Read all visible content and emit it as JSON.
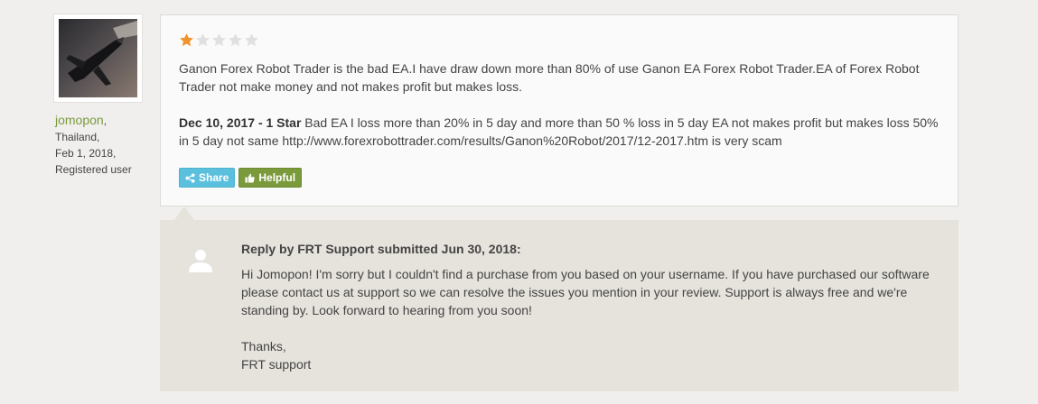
{
  "reviewer": {
    "username": "jomopon",
    "username_suffix": ",",
    "country": "Thailand,",
    "date": "Feb 1, 2018,",
    "role": "Registered user"
  },
  "review": {
    "rating": 1,
    "max_rating": 5,
    "star_filled_color": "#f0932b",
    "star_empty_color": "#e0e0e0",
    "paragraph1": "Ganon Forex Robot Trader is the bad EA.I have draw down more than 80% of use Ganon EA Forex Robot Trader.EA of Forex Robot Trader not make money and not makes profit but makes loss.",
    "update_label": "Dec 10, 2017 - 1 Star",
    "update_text": " Bad EA I loss more than 20% in 5 day and more than 50 % loss in 5 day EA not makes profit but makes loss 50% in 5 day not same http://www.forexrobottrader.com/results/Ganon%20Robot/2017/12-2017.htm is very scam"
  },
  "actions": {
    "share_label": "Share",
    "share_icon": "share-icon",
    "helpful_label": "Helpful",
    "helpful_icon": "thumbs-up-icon"
  },
  "reply": {
    "heading": "Reply by FRT Support submitted Jun 30, 2018:",
    "paragraph1": "Hi Jomopon! I'm sorry but I couldn't find a purchase from you based on your username. If you have purchased our software please contact us at support so we can resolve the issues you mention in your review. Support is always free and we're standing by. Look forward to hearing from you soon!",
    "signoff_line1": "Thanks,",
    "signoff_line2": "FRT support"
  }
}
